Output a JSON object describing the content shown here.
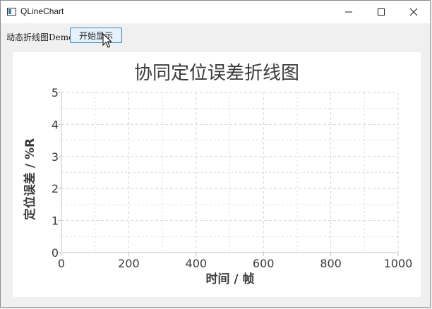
{
  "window": {
    "title": "QLineChart"
  },
  "toolbar": {
    "label": "动态折线图Demo",
    "start_button": "开始显示"
  },
  "chart_data": {
    "type": "line",
    "title": "协同定位误差折线图",
    "xlabel": "时间 / 帧",
    "ylabel": "定位误差 / %R",
    "xlim": [
      0,
      1000
    ],
    "ylim": [
      0,
      5
    ],
    "x_ticks": [
      "0",
      "200",
      "400",
      "600",
      "800",
      "1000"
    ],
    "y_ticks": [
      "0",
      "1",
      "2",
      "3",
      "4",
      "5"
    ],
    "series": [],
    "grid": true
  },
  "colors": {
    "accent": "#3a86c8",
    "button_bg": "#e5f1fb",
    "grid": "#e2e2e2"
  }
}
